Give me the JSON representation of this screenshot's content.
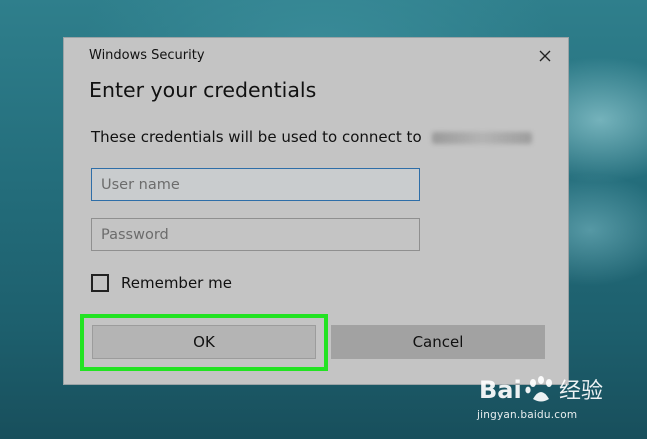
{
  "window": {
    "title": "Windows Security",
    "close_icon": "close-icon"
  },
  "dialog": {
    "heading": "Enter your credentials",
    "description": "These credentials will be used to connect to",
    "username_placeholder": "User name",
    "username_value": "",
    "password_placeholder": "Password",
    "password_value": "",
    "remember_label": "Remember me",
    "remember_checked": false,
    "ok_label": "OK",
    "cancel_label": "Cancel",
    "highlight_color": "#22e322"
  },
  "watermark": {
    "brand": "Bai 经验",
    "url": "jingyan.baidu.com"
  }
}
